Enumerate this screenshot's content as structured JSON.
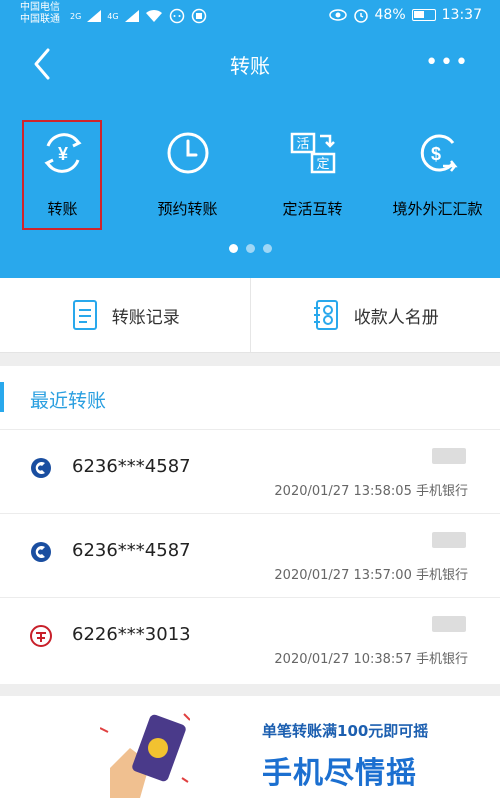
{
  "status": {
    "carrier1": "中国电信",
    "carrier2": "中国联通",
    "net1": "2G",
    "net2": "4G",
    "battery": "48%",
    "time": "13:37"
  },
  "header": {
    "title": "转账"
  },
  "quick": [
    {
      "label": "转账",
      "icon": "yen-transfer-icon"
    },
    {
      "label": "预约转账",
      "icon": "clock-icon"
    },
    {
      "label": "定活互转",
      "icon": "fixed-current-icon",
      "icon_text1": "活",
      "icon_text2": "定"
    },
    {
      "label": "境外外汇汇款",
      "icon": "dollar-globe-icon"
    }
  ],
  "actions": {
    "records": "转账记录",
    "payees": "收款人名册"
  },
  "recent": {
    "title": "最近转账",
    "rows": [
      {
        "account": "6236***4587",
        "meta": "2020/01/27 13:58:05  手机银行",
        "bank": "ccb"
      },
      {
        "account": "6236***4587",
        "meta": "2020/01/27 13:57:00  手机银行",
        "bank": "ccb"
      },
      {
        "account": "6226***3013",
        "meta": "2020/01/27 10:38:57  手机银行",
        "bank": "citic"
      }
    ]
  },
  "banner": {
    "line1": "单笔转账满100元即可摇",
    "line2": "手机尽情摇"
  },
  "colors": {
    "primary": "#29a8ec",
    "highlight": "#d0242b",
    "ccb": "#1a4ea0",
    "citic": "#c8202a"
  }
}
